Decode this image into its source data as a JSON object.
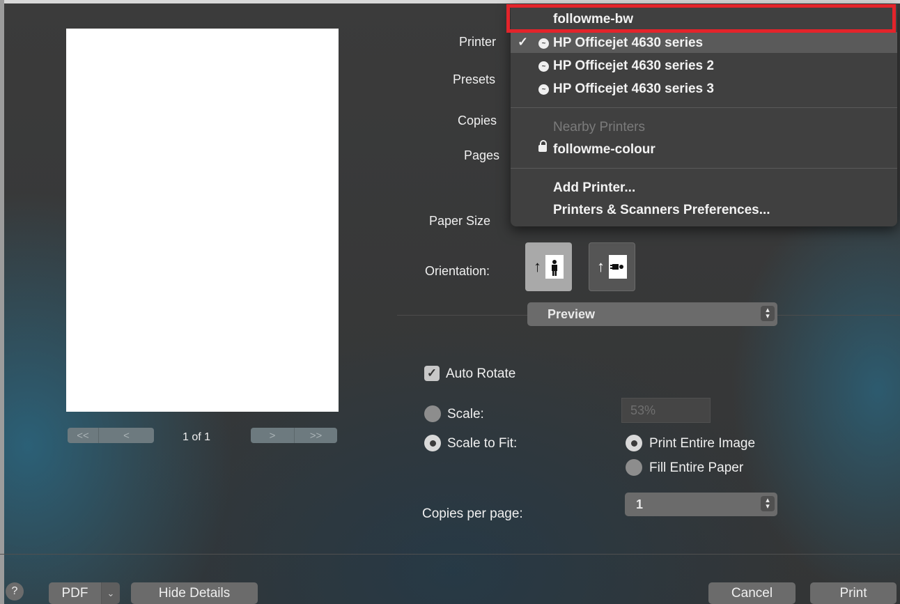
{
  "preview": {
    "page_label": "1 of 1",
    "nav_first": "<<",
    "nav_prev": "<",
    "nav_next": ">",
    "nav_last": ">>"
  },
  "labels": {
    "printer": "Printer",
    "presets": "Presets",
    "copies": "Copies",
    "pages": "Pages",
    "paper_size": "Paper Size",
    "orientation": "Orientation:"
  },
  "section_popup": "Preview",
  "options": {
    "auto_rotate": "Auto Rotate",
    "auto_rotate_checked": true,
    "scale_label": "Scale:",
    "scale_value": "53%",
    "scale_to_fit_label": "Scale to Fit:",
    "print_entire_image": "Print Entire Image",
    "fill_entire_paper": "Fill Entire Paper",
    "copies_per_page_label": "Copies per page:",
    "copies_per_page_value": "1"
  },
  "footer": {
    "help": "?",
    "pdf": "PDF",
    "hide_details": "Hide Details",
    "cancel": "Cancel",
    "print": "Print"
  },
  "printer_menu": {
    "items": [
      {
        "label": "followme-bw"
      },
      {
        "label": "HP Officejet 4630 series",
        "selected": true
      },
      {
        "label": "HP Officejet 4630 series 2"
      },
      {
        "label": "HP Officejet 4630 series 3"
      }
    ],
    "nearby_header": "Nearby Printers",
    "nearby": [
      {
        "label": "followme-colour"
      }
    ],
    "actions": [
      {
        "label": "Add Printer..."
      },
      {
        "label": "Printers & Scanners Preferences..."
      }
    ],
    "check_mark": "✓"
  },
  "colors": {
    "highlight": "#e3242b",
    "menu_bg": "#404040"
  }
}
